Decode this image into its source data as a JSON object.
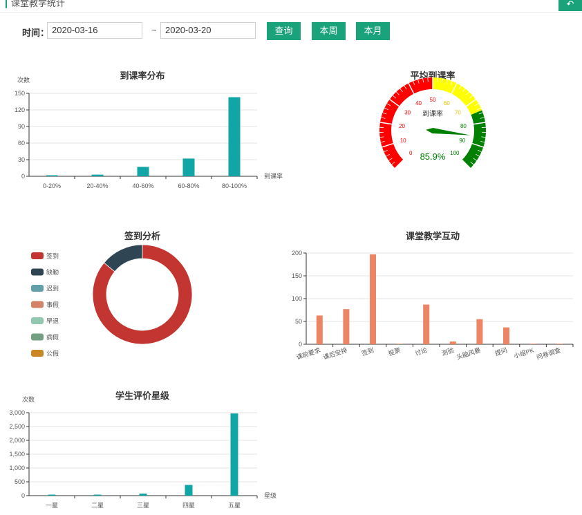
{
  "header": {
    "title": "课堂教学统计",
    "back_icon": "return-icon"
  },
  "filter": {
    "time_label": "时间：",
    "start_date": "2020-03-16",
    "separator": "~",
    "end_date": "2020-03-20",
    "query_label": "查询",
    "this_week_label": "本周",
    "this_month_label": "本月"
  },
  "colors": {
    "accent": "#1aa37a",
    "teal_bar": "#12a5a5",
    "orange_bar": "#ec8563"
  },
  "chart_data": [
    {
      "id": "attendance-distribution",
      "type": "bar",
      "title": "到课率分布",
      "ylabel": "次数",
      "xlabel": "到课率",
      "categories": [
        "0-20%",
        "20-40%",
        "40-60%",
        "60-80%",
        "80-100%"
      ],
      "values": [
        1,
        3,
        17,
        32,
        143
      ],
      "ylim": [
        0,
        150
      ],
      "yticks": [
        "0",
        "30",
        "60",
        "90",
        "120",
        "150"
      ],
      "grid": true
    },
    {
      "id": "average-attendance",
      "type": "gauge",
      "title": "平均到课率",
      "center_label": "到课率",
      "value": 85.9,
      "value_label": "85.9%",
      "min": 0,
      "max": 100,
      "tick_labels": [
        "0",
        "10",
        "20",
        "30",
        "40",
        "50",
        "60",
        "70",
        "80",
        "90",
        "100"
      ],
      "bands": [
        {
          "to": 50,
          "color": "#ff0000"
        },
        {
          "to": 75,
          "color": "#ffff00"
        },
        {
          "to": 100,
          "color": "#008000"
        }
      ]
    },
    {
      "id": "signin-analysis",
      "type": "pie",
      "title": "签到分析",
      "legend_position": "left",
      "slices": [
        {
          "name": "签到",
          "value": 86,
          "color": "#c23531"
        },
        {
          "name": "缺勤",
          "value": 14,
          "color": "#2f4554"
        },
        {
          "name": "迟到",
          "value": 0,
          "color": "#61a0a8"
        },
        {
          "name": "事假",
          "value": 0,
          "color": "#d48265"
        },
        {
          "name": "早退",
          "value": 0,
          "color": "#91c7ae"
        },
        {
          "name": "病假",
          "value": 0,
          "color": "#749f83"
        },
        {
          "name": "公假",
          "value": 0,
          "color": "#ca8622"
        }
      ]
    },
    {
      "id": "classroom-interaction",
      "type": "bar",
      "title": "课堂教学互动",
      "categories": [
        "课前要求",
        "课后安排",
        "签到",
        "投票",
        "讨论",
        "测验",
        "头脑风暴",
        "提问",
        "小组PK",
        "问卷调查"
      ],
      "values": [
        63,
        77,
        197,
        0,
        87,
        6,
        55,
        37,
        0,
        0
      ],
      "ylim": [
        0,
        200
      ],
      "yticks": [
        "0",
        "50",
        "100",
        "150",
        "200"
      ],
      "grid": true
    },
    {
      "id": "student-rating-stars",
      "type": "bar",
      "title": "学生评价星级",
      "ylabel": "次数",
      "xlabel": "星级",
      "categories": [
        "一星",
        "二星",
        "三星",
        "四星",
        "五星"
      ],
      "values": [
        5,
        10,
        80,
        420,
        3220
      ],
      "ylim": [
        0,
        3250
      ],
      "yticks": [
        "0",
        "500",
        "1,000",
        "1,500",
        "2,000",
        "2,500",
        "3,000"
      ],
      "grid": true
    }
  ]
}
